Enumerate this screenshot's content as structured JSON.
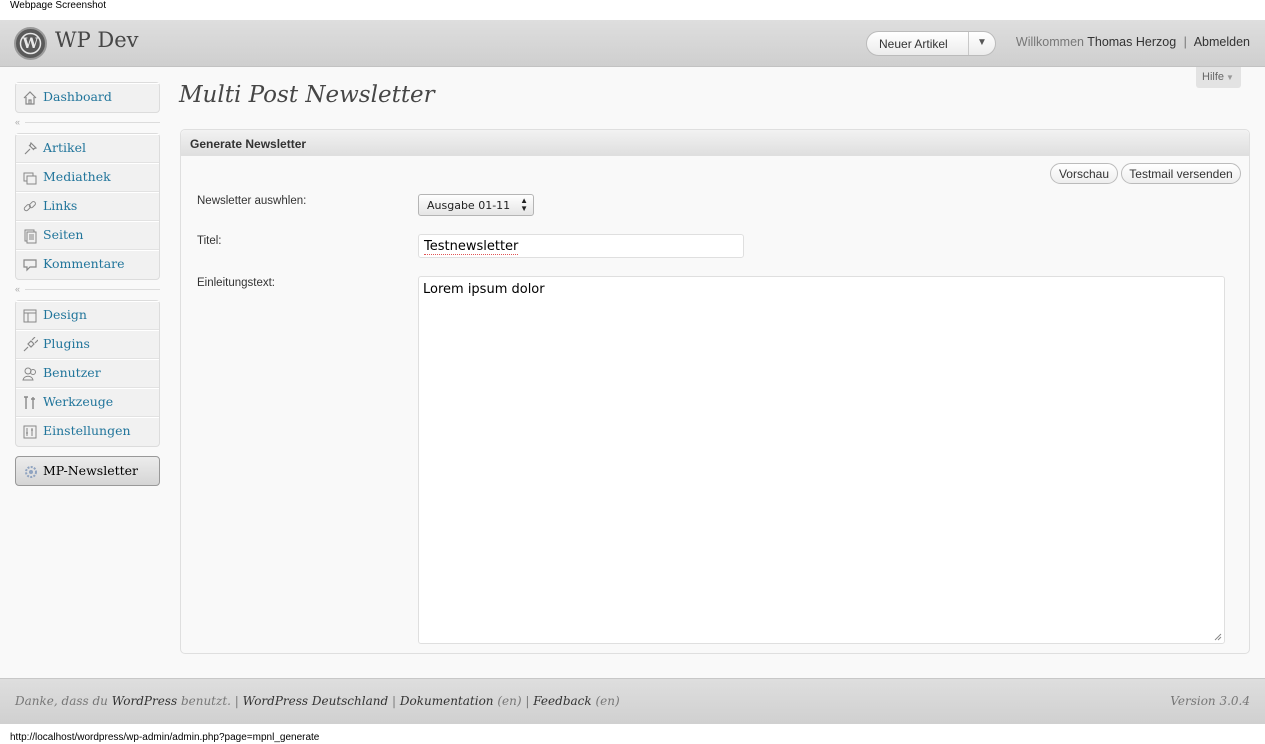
{
  "caption": "Webpage Screenshot",
  "header": {
    "site_title": "WP Dev",
    "favorite": {
      "label": "Neuer Artikel"
    },
    "greeting": "Willkommen",
    "user": "Thomas Herzog",
    "separator": "|",
    "logout": "Abmelden"
  },
  "help_tab": {
    "label": "Hilfe"
  },
  "sidebar": {
    "groups": [
      [
        {
          "label": "Dashboard",
          "icon": "home-icon"
        }
      ],
      [
        {
          "label": "Artikel",
          "icon": "pin-icon"
        },
        {
          "label": "Mediathek",
          "icon": "media-icon"
        },
        {
          "label": "Links",
          "icon": "link-icon"
        },
        {
          "label": "Seiten",
          "icon": "pages-icon"
        },
        {
          "label": "Kommentare",
          "icon": "comment-icon"
        }
      ],
      [
        {
          "label": "Design",
          "icon": "appearance-icon"
        },
        {
          "label": "Plugins",
          "icon": "plugin-icon"
        },
        {
          "label": "Benutzer",
          "icon": "users-icon"
        },
        {
          "label": "Werkzeuge",
          "icon": "tools-icon"
        },
        {
          "label": "Einstellungen",
          "icon": "settings-icon"
        }
      ]
    ],
    "active_item": {
      "label": "MP-Newsletter",
      "icon": "newsletter-gear-icon"
    }
  },
  "main": {
    "page_title": "Multi Post Newsletter",
    "panel": {
      "title": "Generate Newsletter",
      "preview_button": "Vorschau",
      "testmail_button": "Testmail versenden",
      "newsletter_label": "Newsletter auswhlen:",
      "newsletter_value": "Ausgabe 01-11",
      "title_label": "Titel:",
      "title_value": "Testnewsletter",
      "intro_label": "Einleitungstext:",
      "intro_value": "Lorem ipsum dolor"
    }
  },
  "footer": {
    "thanks_prefix": "Danke, dass du",
    "wordpress": "WordPress",
    "thanks_suffix": "benutzt.",
    "sep": "|",
    "wp_de": "WordPress Deutschland",
    "docs": "Dokumentation",
    "en": "(en)",
    "feedback": "Feedback",
    "version": "Version 3.0.4"
  },
  "statusbar": "http://localhost/wordpress/wp-admin/admin.php?page=mpnl_generate"
}
